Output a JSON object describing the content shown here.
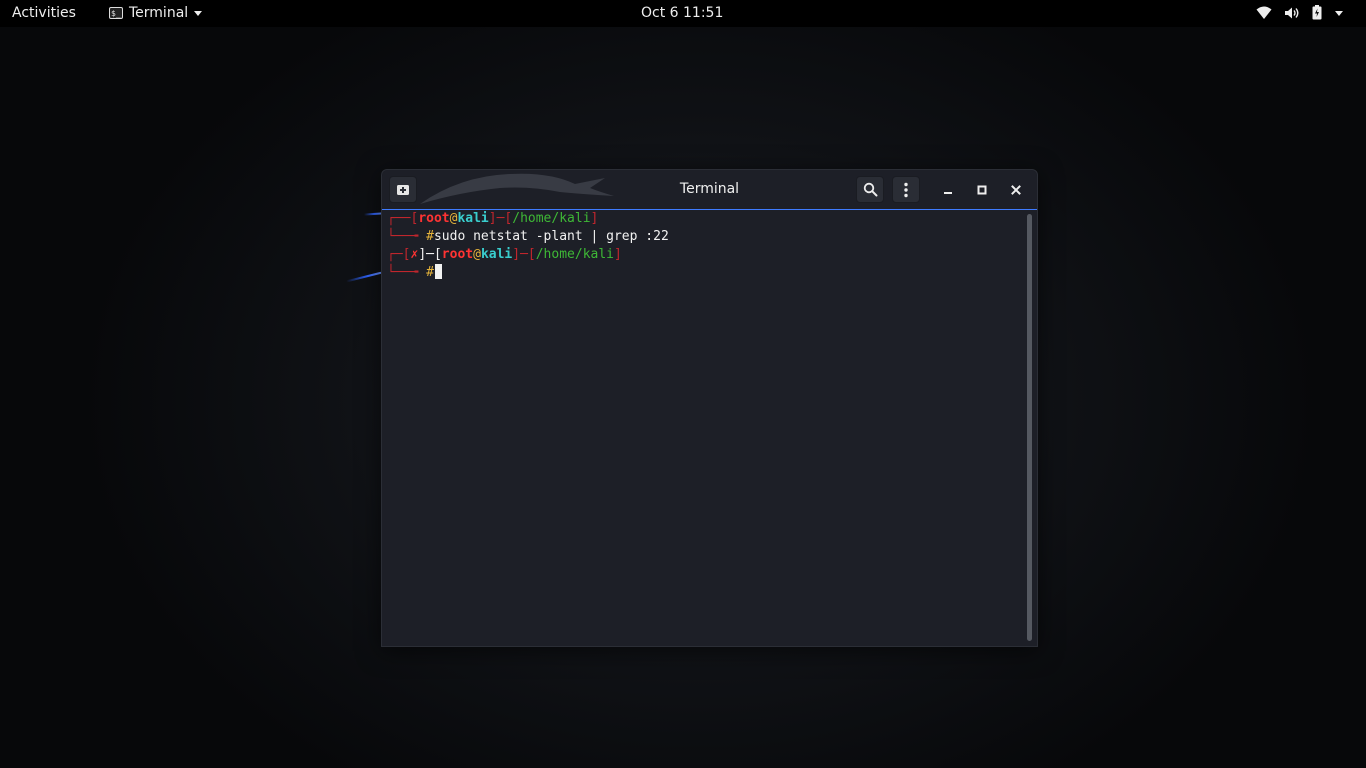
{
  "topbar": {
    "activities": "Activities",
    "app_name": "Terminal",
    "app_icon_glyph": "$_",
    "clock": "Oct 6  11:51",
    "tray_icons": [
      "wifi-icon",
      "volume-icon",
      "battery-icon",
      "power-menu-caret-icon"
    ]
  },
  "window": {
    "title": "Terminal",
    "header_buttons": [
      "new-tab-icon",
      "search-icon",
      "menu-kebab-icon"
    ],
    "controls": [
      "minimize-icon",
      "maximize-icon",
      "close-icon"
    ],
    "accent_color": "#3e7bff"
  },
  "terminal": {
    "line1": {
      "corner": "┌──",
      "open": "[",
      "user": "root",
      "at": "@",
      "host": "kali",
      "close": "]",
      "dash": "─",
      "path_open": "[",
      "path": "/home/kali",
      "path_close": "]"
    },
    "line2": {
      "corner": "└──╼ ",
      "hash": "#",
      "command": "sudo netstat -plant | grep :22"
    },
    "line3": {
      "corner": "┌─",
      "status_open": "[",
      "status": "✗",
      "status_close": "]",
      "dash1": "─",
      "open": "[",
      "user": "root",
      "at": "@",
      "host": "kali",
      "close": "]",
      "dash2": "─",
      "path_open": "[",
      "path": "/home/kali",
      "path_close": "]"
    },
    "line4": {
      "corner": "└──╼ ",
      "hash": "#"
    }
  },
  "colors": {
    "prompt_red": "#c0262d",
    "user_red": "#ff3333",
    "host_cyan": "#39cdcd",
    "at_yellow": "#e5b33b",
    "path_green": "#3eb836"
  }
}
